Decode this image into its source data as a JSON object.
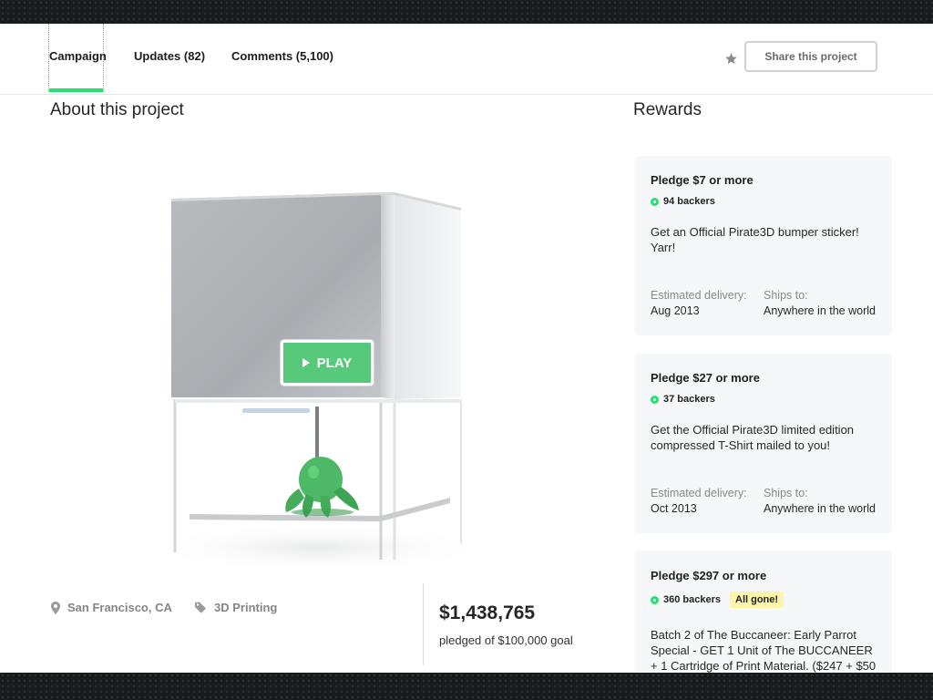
{
  "nav": {
    "tabs": [
      {
        "label": "Campaign"
      },
      {
        "label": "Updates (82)"
      },
      {
        "label": "Comments (5,100)"
      }
    ],
    "share_label": "Share this project",
    "star_icon": "star-icon"
  },
  "about": {
    "title": "About this project",
    "play_label": "PLAY",
    "location": "San Francisco, CA",
    "category": "3D Printing",
    "pledged_amount": "$1,438,765",
    "pledged_goal": "pledged of $100,000 goal"
  },
  "rewards": {
    "title": "Rewards",
    "delivery_label": "Estimated delivery:",
    "ships_label": "Ships to:",
    "items": [
      {
        "pledge": "Pledge $7 or more",
        "backers": "94 backers",
        "description": "Get an Official Pirate3D bumper sticker! Yarr!",
        "delivery": "Aug 2013",
        "ships": "Anywhere in the world"
      },
      {
        "pledge": "Pledge $27 or more",
        "backers": "37 backers",
        "description": "Get the Official Pirate3D limited edition compressed T-Shirt mailed to you!",
        "delivery": "Oct 2013",
        "ships": "Anywhere in the world"
      },
      {
        "pledge": "Pledge $297 or more",
        "backers": "360 backers",
        "badge": "All gone!",
        "description": "Batch 2 of The Buccaneer: Early Parrot Special - GET 1 Unit of The BUCCANEER + 1 Cartridge of Print Material. ($247 + $50"
      }
    ]
  },
  "colors": {
    "accent_green": "#2bde73",
    "play_green": "#57c97a",
    "badge_yellow": "#fff5a8"
  }
}
